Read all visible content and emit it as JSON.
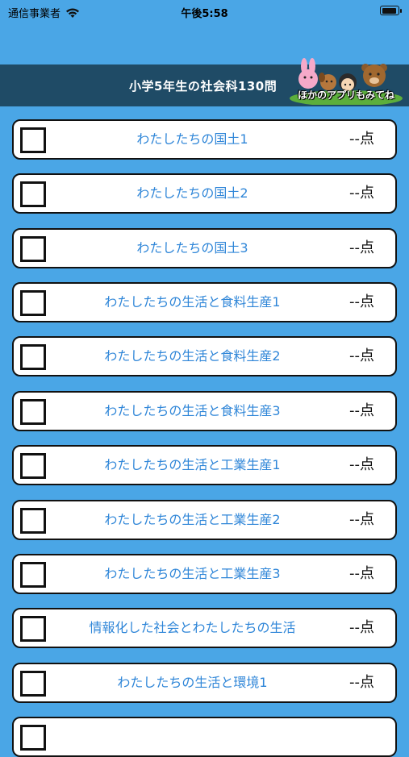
{
  "status_bar": {
    "carrier": "通信事業者",
    "time": "午後5:58"
  },
  "header": {
    "title": "小学5年生の社会科130問",
    "promo_label": "ほかのアプリもみてね"
  },
  "units": [
    {
      "title": "わたしたちの国土1",
      "score": "--点"
    },
    {
      "title": "わたしたちの国土2",
      "score": "--点"
    },
    {
      "title": "わたしたちの国土3",
      "score": "--点"
    },
    {
      "title": "わたしたちの生活と食料生産1",
      "score": "--点"
    },
    {
      "title": "わたしたちの生活と食料生産2",
      "score": "--点"
    },
    {
      "title": "わたしたちの生活と食料生産3",
      "score": "--点"
    },
    {
      "title": "わたしたちの生活と工業生産1",
      "score": "--点"
    },
    {
      "title": "わたしたちの生活と工業生産2",
      "score": "--点"
    },
    {
      "title": "わたしたちの生活と工業生産3",
      "score": "--点"
    },
    {
      "title": "情報化した社会とわたしたちの生活",
      "score": "--点"
    },
    {
      "title": "わたしたちの生活と環境1",
      "score": "--点"
    },
    {
      "title": "",
      "score": ""
    }
  ]
}
